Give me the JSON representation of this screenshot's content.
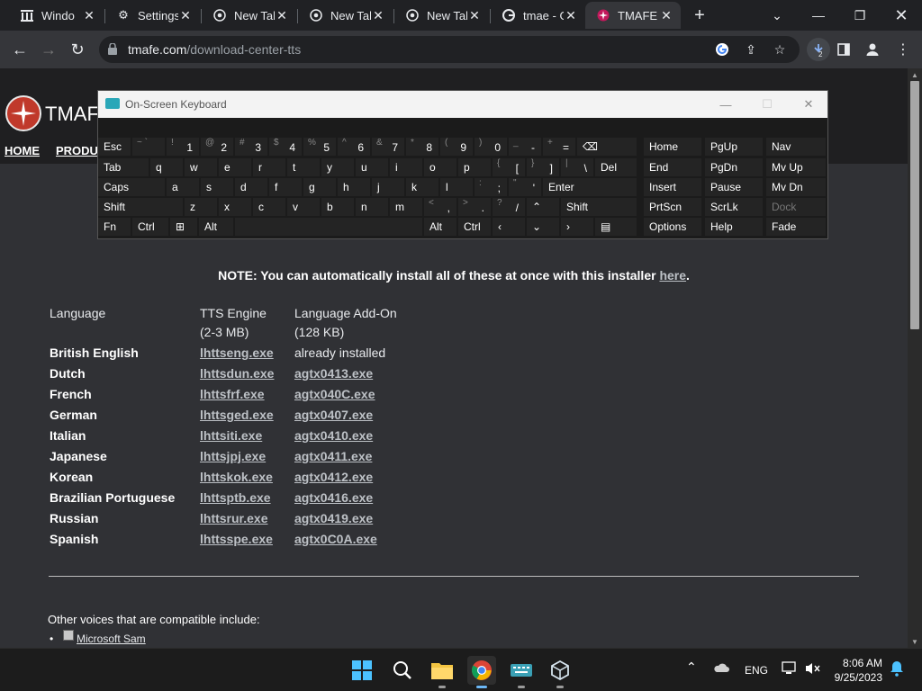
{
  "tabs": [
    {
      "title": "Windo",
      "icon": "columns-icon"
    },
    {
      "title": "Settings",
      "icon": "gear-icon"
    },
    {
      "title": "New Tab",
      "icon": "chrome-icon"
    },
    {
      "title": "New Tab",
      "icon": "chrome-icon"
    },
    {
      "title": "New Tab",
      "icon": "chrome-icon"
    },
    {
      "title": "tmae - G",
      "icon": "google-icon"
    },
    {
      "title": "TMAFE",
      "icon": "tmafe-icon",
      "active": true
    }
  ],
  "toolbar": {
    "url_domain": "tmafe.com",
    "url_path": "/download-center-tts",
    "download_badge": "2"
  },
  "page": {
    "site_name": "TMAFE",
    "nav": [
      "HOME",
      "PRODU"
    ],
    "note_text": "NOTE: You can automatically install all of these at once with this installer ",
    "note_link": "here",
    "note_end": ".",
    "headers": {
      "language": "Language",
      "engine": "TTS Engine",
      "engine_size": "(2-3 MB)",
      "addon": "Language Add-On",
      "addon_size": "(128 KB)"
    },
    "rows": [
      {
        "language": "British English",
        "engine": "lhttseng.exe",
        "addon": "already installed"
      },
      {
        "language": "Dutch",
        "engine": "lhttsdun.exe",
        "addon": "agtx0413.exe"
      },
      {
        "language": "French",
        "engine": "lhttsfrf.exe",
        "addon": "agtx040C.exe"
      },
      {
        "language": "German",
        "engine": "lhttsged.exe",
        "addon": "agtx0407.exe"
      },
      {
        "language": "Italian",
        "engine": "lhttsiti.exe",
        "addon": "agtx0410.exe"
      },
      {
        "language": "Japanese",
        "engine": "lhttsjpj.exe",
        "addon": "agtx0411.exe"
      },
      {
        "language": "Korean",
        "engine": "lhttskok.exe",
        "addon": "agtx0412.exe"
      },
      {
        "language": "Brazilian Portuguese",
        "engine": "lhttsptb.exe",
        "addon": "agtx0416.exe"
      },
      {
        "language": "Russian",
        "engine": "lhttsrur.exe",
        "addon": "agtx0419.exe"
      },
      {
        "language": "Spanish",
        "engine": "lhttsspe.exe",
        "addon": "agtx0C0A.exe"
      }
    ],
    "other_voices": "Other voices that are compatible include:",
    "voice_item": "Microsoft Sam"
  },
  "osk": {
    "title": "On-Screen Keyboard",
    "row1": [
      {
        "sm": "",
        "lg": "Esc"
      },
      {
        "sm": "~ `",
        "lg": ""
      },
      {
        "sm": "!",
        "lg": "1"
      },
      {
        "sm": "@",
        "lg": "2"
      },
      {
        "sm": "#",
        "lg": "3"
      },
      {
        "sm": "$",
        "lg": "4"
      },
      {
        "sm": "%",
        "lg": "5"
      },
      {
        "sm": "^",
        "lg": "6"
      },
      {
        "sm": "&",
        "lg": "7"
      },
      {
        "sm": "*",
        "lg": "8"
      },
      {
        "sm": "(",
        "lg": "9"
      },
      {
        "sm": ")",
        "lg": "0"
      },
      {
        "sm": "_",
        "lg": "-"
      },
      {
        "sm": "+",
        "lg": "="
      },
      {
        "sm": "",
        "lg": "⌫"
      }
    ],
    "row2": [
      "Tab",
      "q",
      "w",
      "e",
      "r",
      "t",
      "y",
      "u",
      "i",
      "o",
      "p",
      "[",
      "]",
      "\\",
      "Del"
    ],
    "row2_sm": [
      "",
      "",
      "",
      "",
      "",
      "",
      "",
      "",
      "",
      "",
      "",
      "{",
      "}",
      "|",
      ""
    ],
    "row3": [
      "Caps",
      "a",
      "s",
      "d",
      "f",
      "g",
      "h",
      "j",
      "k",
      "l",
      ";",
      "'",
      "Enter"
    ],
    "row3_sm": [
      "",
      "",
      "",
      "",
      "",
      "",
      "",
      "",
      "",
      "",
      ":",
      "\"",
      ""
    ],
    "row4": [
      "Shift",
      "z",
      "x",
      "c",
      "v",
      "b",
      "n",
      "m",
      ",",
      ".",
      "/",
      "^",
      "Shift"
    ],
    "row4_sm": [
      "",
      "",
      "",
      "",
      "",
      "",
      "",
      "",
      "<",
      ">",
      "?",
      "",
      ""
    ],
    "row5": [
      "Fn",
      "Ctrl",
      "win",
      "Alt",
      "",
      "Alt",
      "Ctrl",
      "<",
      "v",
      ">",
      "menu"
    ],
    "right_keys": [
      [
        "Home",
        "PgUp",
        "Nav"
      ],
      [
        "End",
        "PgDn",
        "Mv Up"
      ],
      [
        "Insert",
        "Pause",
        "Mv Dn"
      ],
      [
        "PrtScn",
        "ScrLk",
        "Dock"
      ],
      [
        "Options",
        "Help",
        "Fade"
      ]
    ]
  },
  "taskbar": {
    "lang": "ENG",
    "time": "8:06 AM",
    "date": "9/25/2023"
  }
}
